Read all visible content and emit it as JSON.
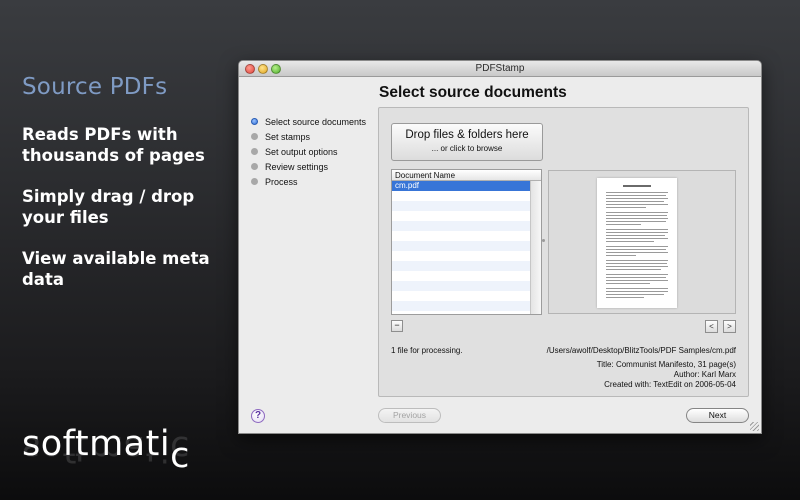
{
  "promo": {
    "title": "Source PDFs",
    "features": [
      "Reads PDFs with thousands of pages",
      "Simply drag / drop your files",
      "View available meta data"
    ],
    "brand_main": "softmati",
    "brand_sub": "c"
  },
  "window": {
    "title": "PDFStamp",
    "steps": [
      {
        "label": "Select source documents",
        "active": true
      },
      {
        "label": "Set stamps",
        "active": false
      },
      {
        "label": "Set output options",
        "active": false
      },
      {
        "label": "Review settings",
        "active": false
      },
      {
        "label": "Process",
        "active": false
      }
    ],
    "heading": "Select source documents",
    "drop_main": "Drop files & folders here",
    "drop_sub": "... or click to browse",
    "table": {
      "column": "Document Name",
      "rows": [
        "cm.pdf"
      ]
    },
    "remove_label": "−",
    "prev_page_label": "<",
    "next_page_label": ">",
    "file_count": "1 file for processing.",
    "file_path": "/Users/awolf/Desktop/BlitzTools/PDF Samples/cm.pdf",
    "meta": {
      "title": "Title: Communist Manifesto, 31 page(s)",
      "author": "Author: Karl Marx",
      "created": "Created with: TextEdit on 2006-05-04"
    },
    "previous_label": "Previous",
    "next_label": "Next",
    "help_label": "?"
  },
  "colors": {
    "accent": "#7f9bc4",
    "selection": "#3875d7"
  }
}
